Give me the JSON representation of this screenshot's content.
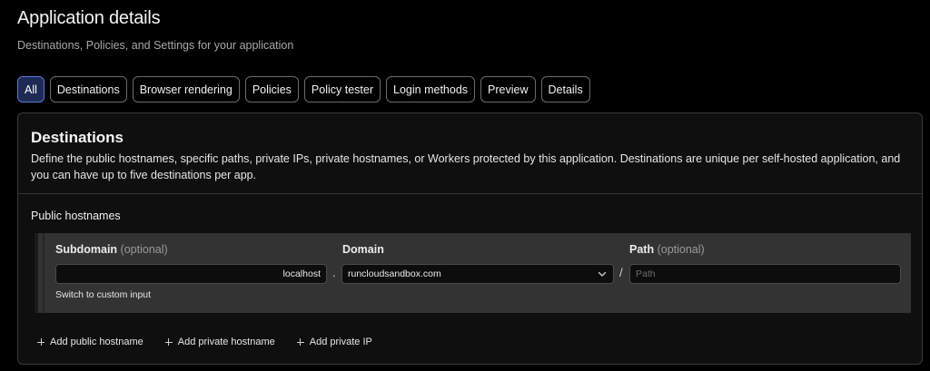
{
  "header": {
    "title": "Application details",
    "subtitle": "Destinations, Policies, and Settings for your application"
  },
  "tabs": [
    {
      "label": "All",
      "active": true
    },
    {
      "label": "Destinations",
      "active": false
    },
    {
      "label": "Browser rendering",
      "active": false
    },
    {
      "label": "Policies",
      "active": false
    },
    {
      "label": "Policy tester",
      "active": false
    },
    {
      "label": "Login methods",
      "active": false
    },
    {
      "label": "Preview",
      "active": false
    },
    {
      "label": "Details",
      "active": false
    }
  ],
  "destinations": {
    "title": "Destinations",
    "description": "Define the public hostnames, specific paths, private IPs, private hostnames, or Workers protected by this application. Destinations are unique per self-hosted application, and you can have up to five destinations per app.",
    "public_hostnames_label": "Public hostnames",
    "subdomain": {
      "label": "Subdomain",
      "optional": "(optional)",
      "value": "localhost"
    },
    "dot": ".",
    "domain": {
      "label": "Domain",
      "value": "runcloudsandbox.com"
    },
    "slash": "/",
    "path": {
      "label": "Path",
      "optional": "(optional)",
      "value": "",
      "placeholder": "Path"
    },
    "switch_link": "Switch to custom input",
    "actions": {
      "add_public": "Add public hostname",
      "add_private_hostname": "Add private hostname",
      "add_private_ip": "Add private IP"
    }
  },
  "colors": {
    "active_tab_bg": "#1e2a55",
    "active_tab_border": "#5d77d6",
    "row_bg": "#333333"
  },
  "icons": [
    "chevron-down-icon",
    "plus-icon"
  ]
}
